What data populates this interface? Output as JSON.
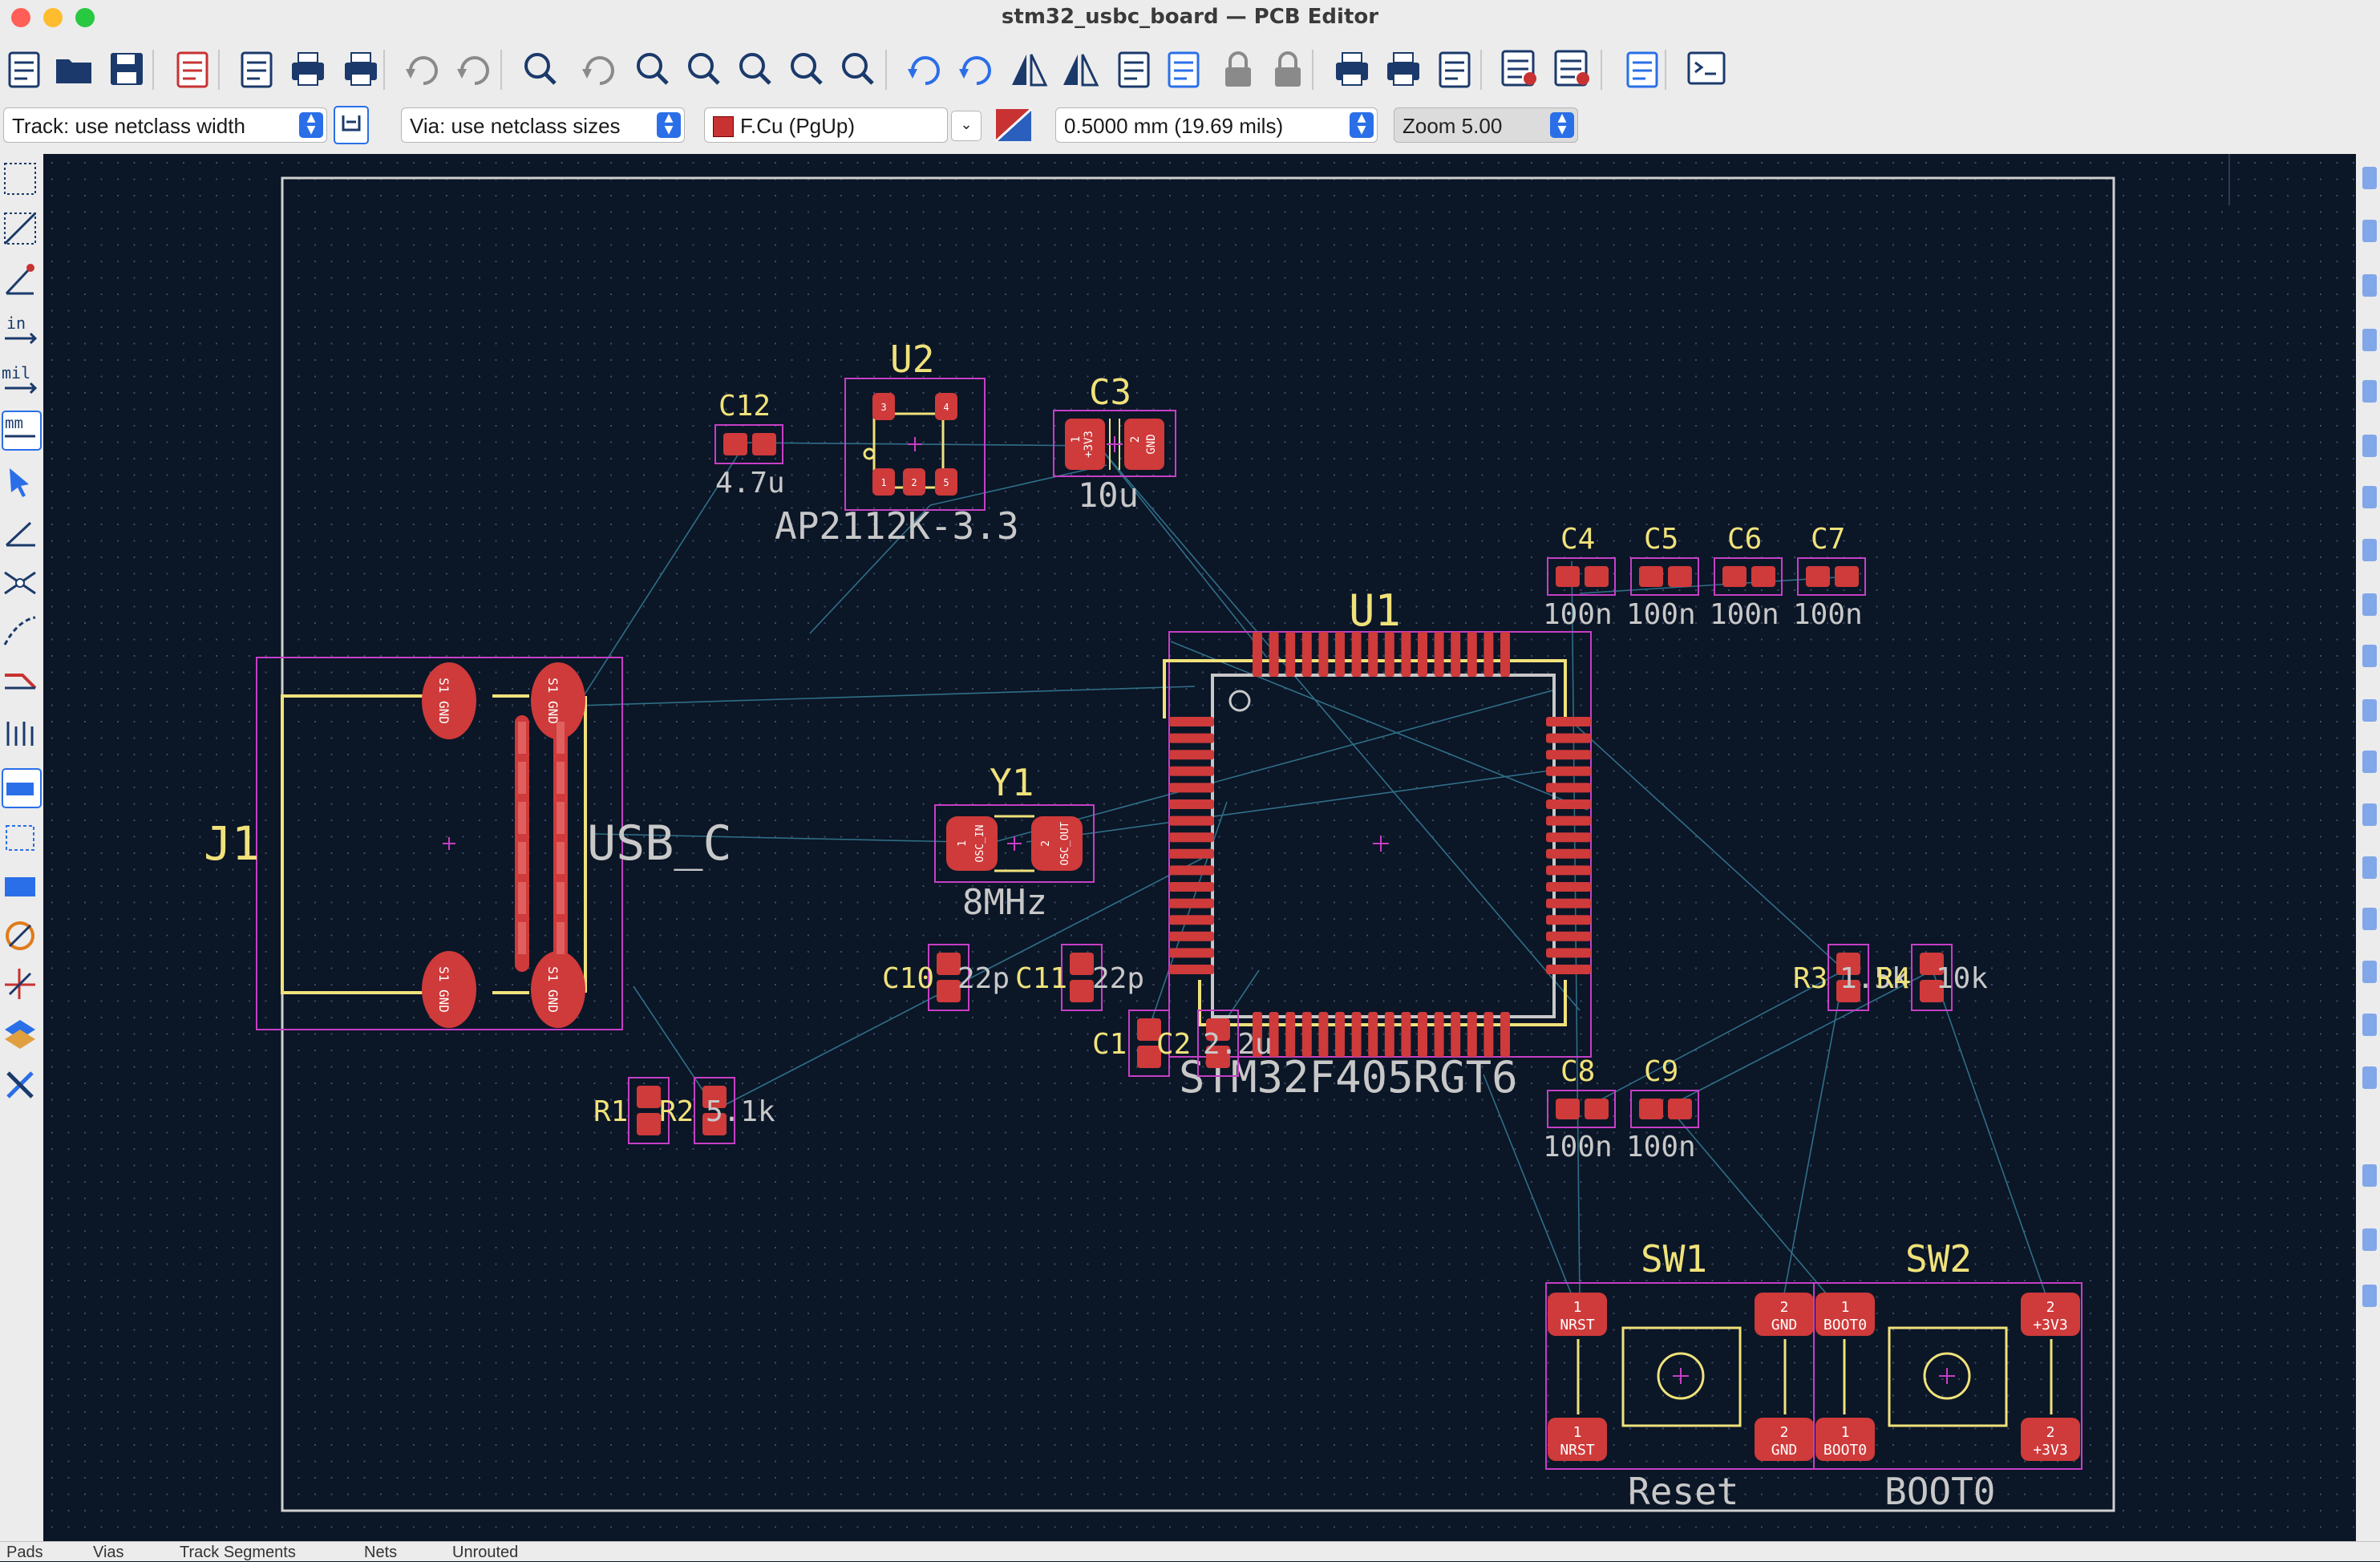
{
  "window": {
    "title": "stm32_usbc_board — PCB Editor"
  },
  "toolbar": {
    "icons": [
      "new-file-icon",
      "open-folder-icon",
      "save-icon",
      "board-setup-icon",
      "page-settings-icon",
      "print-icon",
      "plot-icon",
      "undo-icon",
      "redo-icon",
      "find-icon",
      "refresh-icon",
      "zoom-in-icon",
      "zoom-out-icon",
      "zoom-fit-icon",
      "zoom-objects-icon",
      "zoom-selection-icon",
      "rotate-ccw-icon",
      "rotate-cw-icon",
      "flip-icon",
      "mirror-icon",
      "group-icon",
      "ungroup-icon",
      "lock-icon",
      "unlock-icon",
      "footprint-editor-icon",
      "footprint-browser-icon",
      "update-pcb-icon",
      "netlist-icon",
      "drc-icon",
      "schematic-icon",
      "scripting-console-icon"
    ]
  },
  "options": {
    "track_width": "Track: use netclass width",
    "via_size": "Via: use netclass sizes",
    "layer": "F.Cu (PgUp)",
    "grid": "0.5000 mm (19.69 mils)",
    "zoom": "Zoom 5.00"
  },
  "statusbar": {
    "pads": "Pads",
    "vias": "Vias",
    "track_segments": "Track Segments",
    "nets": "Nets",
    "unrouted": "Unrouted"
  },
  "left_tools": {
    "in_label": "in",
    "mil_label": "mil",
    "mm_label": "mm"
  },
  "board": {
    "colors": {
      "background": "#0b1627",
      "edge": "#d0d0d0",
      "pad": "#cf3a3a",
      "silk": "#f0e27a",
      "courtyard": "#c63fc6",
      "ratsnest": "#2f6f87",
      "ref": "#f0e27a",
      "value": "#c8c8c8"
    },
    "components": {
      "j1": {
        "ref": "J1",
        "value": "USB_C",
        "pad_label": "S1 GND"
      },
      "u2": {
        "ref": "U2",
        "value": "AP2112K-3.3",
        "pads": [
          "3",
          "4",
          "1",
          "2",
          "5"
        ]
      },
      "c12": {
        "ref": "C12",
        "value": "4.7u"
      },
      "c3": {
        "ref": "C3",
        "value": "10u",
        "pad1": "+3V3",
        "pad2": "GND",
        "pad1_num": "1",
        "pad2_num": "2"
      },
      "c4": {
        "ref": "C4",
        "value": "100n"
      },
      "c5": {
        "ref": "C5",
        "value": "100n"
      },
      "c6": {
        "ref": "C6",
        "value": "100n"
      },
      "c7": {
        "ref": "C7",
        "value": "100n"
      },
      "u1": {
        "ref": "U1",
        "value": "STM32F405RGT6"
      },
      "y1": {
        "ref": "Y1",
        "value": "8MHz",
        "pad1": "OSC_IN",
        "pad2": "OSC_OUT",
        "pad1_num": "1",
        "pad2_num": "2"
      },
      "c10": {
        "ref": "C10",
        "value": "22p"
      },
      "c11": {
        "ref": "C11",
        "value": "22p"
      },
      "c1": {
        "ref": "C1"
      },
      "c2": {
        "ref": "C2",
        "value": "2.2u"
      },
      "c8": {
        "ref": "C8",
        "value": "100n"
      },
      "c9": {
        "ref": "C9",
        "value": "100n"
      },
      "r1": {
        "ref": "R1"
      },
      "r2": {
        "ref": "R2",
        "value": "5.1k"
      },
      "r3": {
        "ref": "R3",
        "value": "1.5k"
      },
      "r4": {
        "ref": "R4",
        "value": "10k"
      },
      "sw1": {
        "ref": "SW1",
        "value": "Reset",
        "pad_l": "NRST",
        "pad_r": "GND",
        "pad_l_num": "1",
        "pad_r_num": "2"
      },
      "sw2": {
        "ref": "SW2",
        "value": "BOOT0",
        "pad_l": "BOOT0",
        "pad_r": "+3V3",
        "pad_l_num": "1",
        "pad_r_num": "2"
      }
    }
  }
}
